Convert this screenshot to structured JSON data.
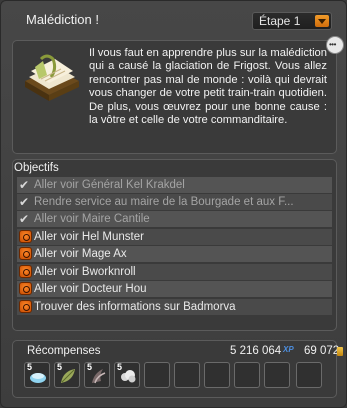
{
  "window": {
    "title": "Malédiction !",
    "step_select": {
      "value": "Étape 1"
    }
  },
  "description": {
    "text": "Il vous faut en apprendre plus sur la malédiction qui a causé la glaciation de Frigost. Vous allez rencontrer pas mal de monde : voilà qui devrait vous changer de votre petit train-train quotidien. De plus, vous œuvrez pour une bonne cause : la vôtre et celle de votre commanditaire."
  },
  "objectives": {
    "header": "Objectifs",
    "items": [
      {
        "label": "Aller voir Général Kel Krakdel",
        "done": true,
        "icon": "check-icon"
      },
      {
        "label": "Rendre service au maire de la Bourgade et aux F...",
        "done": true,
        "icon": "check-icon"
      },
      {
        "label": "Aller voir Maire Cantile",
        "done": true,
        "icon": "check-icon"
      },
      {
        "label": "Aller voir Hel Munster",
        "done": false,
        "icon": "go-icon"
      },
      {
        "label": "Aller voir Mage Ax",
        "done": false,
        "icon": "go-icon"
      },
      {
        "label": "Aller voir Bworknroll",
        "done": false,
        "icon": "go-icon"
      },
      {
        "label": "Aller voir Docteur Hou",
        "done": false,
        "icon": "go-icon"
      },
      {
        "label": "Trouver des informations sur Badmorva",
        "done": false,
        "icon": "go-icon"
      }
    ]
  },
  "rewards": {
    "header": "Récompenses",
    "xp": "5 216 064",
    "xp_unit": "XP",
    "kamas": "69 072",
    "items": [
      {
        "qty": "5",
        "icon": "ice-item-icon"
      },
      {
        "qty": "5",
        "icon": "leaf-item-icon"
      },
      {
        "qty": "5",
        "icon": "claw-item-icon"
      },
      {
        "qty": "5",
        "icon": "cloud-item-icon"
      }
    ],
    "empty_slots": 6
  },
  "colors": {
    "accent_orange": "#e8821a",
    "xp_blue": "#4d8fe0",
    "panel_bg": "#3a3a3a"
  }
}
